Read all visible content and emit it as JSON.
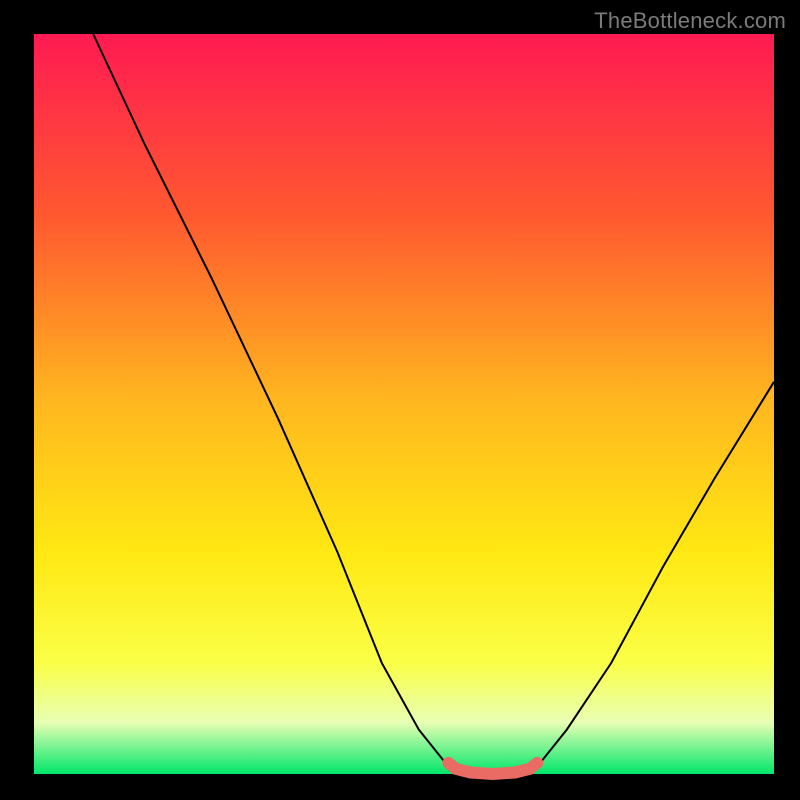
{
  "watermark": "TheBottleneck.com",
  "chart_data": {
    "type": "line",
    "title": "",
    "xlabel": "",
    "ylabel": "",
    "xlim": [
      0,
      100
    ],
    "ylim": [
      0,
      100
    ],
    "grid": false,
    "legend": false,
    "background_gradient": {
      "stops": [
        {
          "pos": 0.0,
          "color": "#ff1a52"
        },
        {
          "pos": 0.25,
          "color": "#ff5a2f"
        },
        {
          "pos": 0.5,
          "color": "#ffb81f"
        },
        {
          "pos": 0.7,
          "color": "#ffe813"
        },
        {
          "pos": 0.85,
          "color": "#faff47"
        },
        {
          "pos": 0.93,
          "color": "#e8ffb4"
        },
        {
          "pos": 1.0,
          "color": "#00e66a"
        }
      ]
    },
    "series": [
      {
        "name": "curve",
        "color": "#000000",
        "stroke_width": 2,
        "points": [
          {
            "x": 8,
            "y": 100
          },
          {
            "x": 15,
            "y": 85
          },
          {
            "x": 24,
            "y": 67
          },
          {
            "x": 33,
            "y": 48
          },
          {
            "x": 41,
            "y": 30
          },
          {
            "x": 47,
            "y": 15
          },
          {
            "x": 52,
            "y": 6
          },
          {
            "x": 56,
            "y": 1
          },
          {
            "x": 59,
            "y": 0
          },
          {
            "x": 62,
            "y": 0
          },
          {
            "x": 65,
            "y": 0
          },
          {
            "x": 68,
            "y": 1
          },
          {
            "x": 72,
            "y": 6
          },
          {
            "x": 78,
            "y": 15
          },
          {
            "x": 85,
            "y": 28
          },
          {
            "x": 92,
            "y": 40
          },
          {
            "x": 100,
            "y": 53
          }
        ]
      },
      {
        "name": "highlight",
        "color": "#e96b63",
        "stroke_width": 12,
        "points": [
          {
            "x": 56,
            "y": 1.5
          },
          {
            "x": 57,
            "y": 0.7
          },
          {
            "x": 59,
            "y": 0.2
          },
          {
            "x": 62,
            "y": 0
          },
          {
            "x": 65,
            "y": 0.2
          },
          {
            "x": 67,
            "y": 0.7
          },
          {
            "x": 68,
            "y": 1.5
          }
        ]
      }
    ]
  }
}
